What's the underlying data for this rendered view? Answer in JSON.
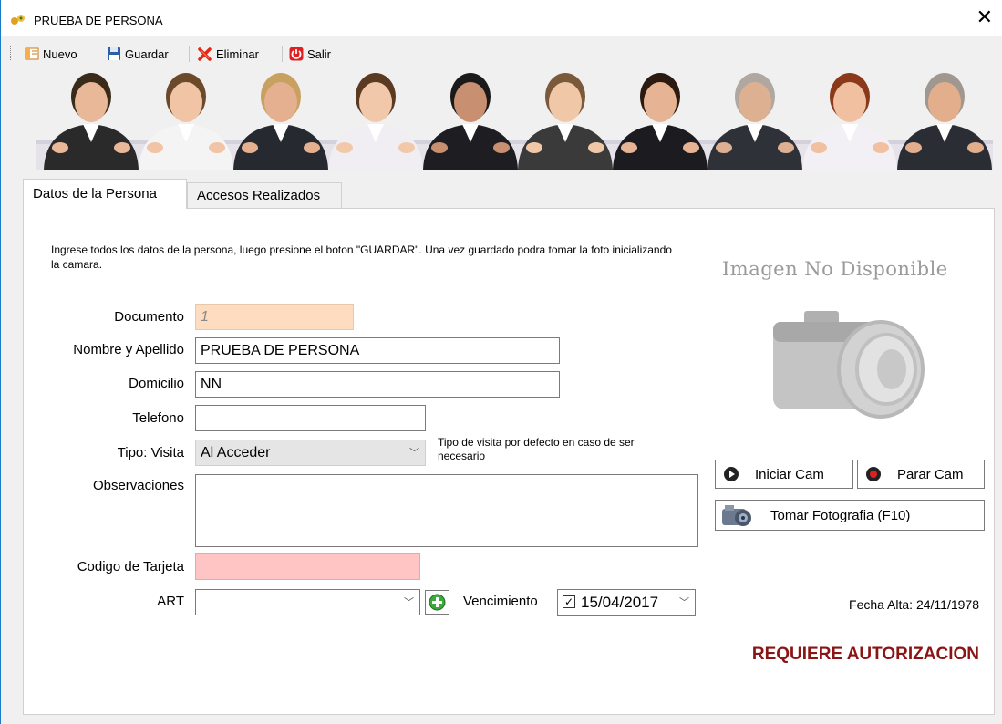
{
  "window": {
    "title": "PRUEBA DE PERSONA",
    "close_glyph": "✕"
  },
  "toolbar": {
    "nuevo": "Nuevo",
    "guardar": "Guardar",
    "eliminar": "Eliminar",
    "salir": "Salir"
  },
  "tabs": [
    {
      "label": "Datos de la Persona",
      "active": true
    },
    {
      "label": "Accesos Realizados",
      "active": false
    }
  ],
  "instructions": "Ingrese todos los datos de la persona, luego presione el boton \"GUARDAR\". Una vez guardado podra tomar la foto inicializando la camara.",
  "form": {
    "documento_label": "Documento",
    "documento_value": "1",
    "nombre_label": "Nombre y Apellido",
    "nombre_value": "PRUEBA DE PERSONA",
    "domicilio_label": "Domicilio",
    "domicilio_value": "NN",
    "telefono_label": "Telefono",
    "telefono_value": "",
    "tipo_label": "Tipo: Visita",
    "tipo_value": "Al Acceder",
    "tipo_note": "Tipo de visita por defecto en caso de ser necesario",
    "observaciones_label": "Observaciones",
    "observaciones_value": "",
    "tarjeta_label": "Codigo de Tarjeta",
    "tarjeta_value": "",
    "art_label": "ART",
    "art_value": "",
    "vencimiento_label": "Vencimiento",
    "vencimiento_value": "15/04/2017",
    "vencimiento_checked": true
  },
  "photo": {
    "placeholder_text": "Imagen No Disponible"
  },
  "camera": {
    "iniciar": "Iniciar Cam",
    "parar": "Parar Cam",
    "tomar": "Tomar Fotografia (F10)"
  },
  "fecha_alta": "Fecha Alta: 24/11/1978",
  "status": "REQUIERE AUTORIZACION",
  "colors": {
    "documento_bg": "#fddcc0",
    "tarjeta_bg": "#ffc4c4",
    "status_color": "#8b1414",
    "window_border": "#1979ca"
  }
}
